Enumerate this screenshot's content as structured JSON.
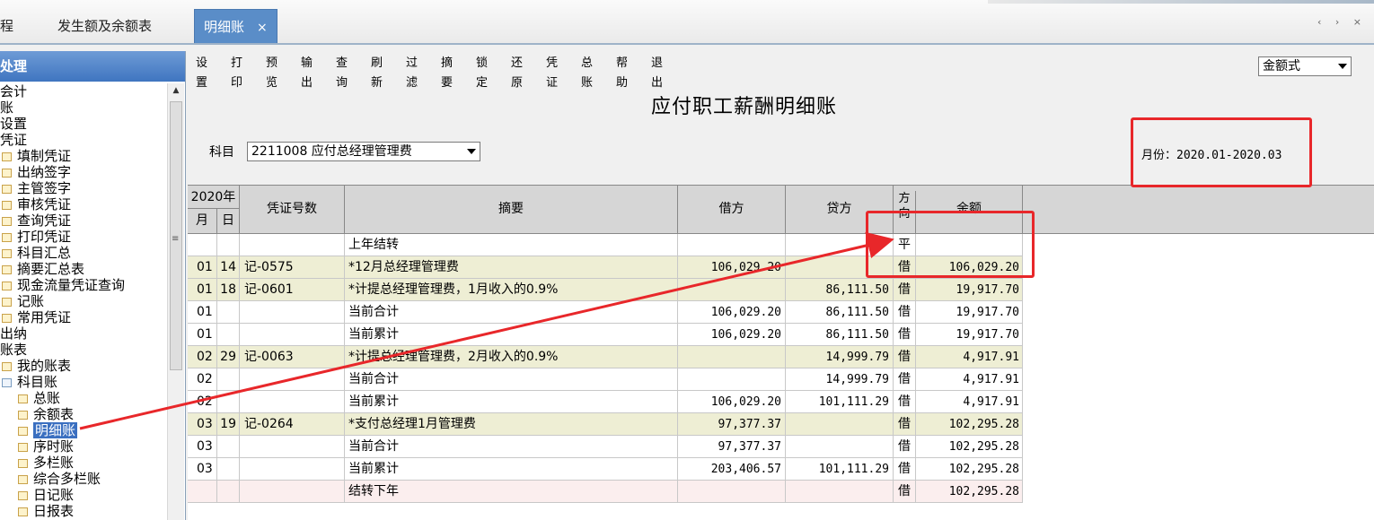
{
  "tabs": [
    {
      "label": "程"
    },
    {
      "label": "发生额及余额表"
    },
    {
      "label": "明细账",
      "active": true,
      "close": "×"
    }
  ],
  "tab_nav": "‹ › ×",
  "left_panel": {
    "header": "处理",
    "tree": [
      {
        "label": "会计",
        "indent": 0,
        "icon": "none"
      },
      {
        "label": "账",
        "indent": 0,
        "icon": "none"
      },
      {
        "label": "设置",
        "indent": 0,
        "icon": "none"
      },
      {
        "label": "凭证",
        "indent": 0,
        "icon": "none"
      },
      {
        "label": "填制凭证",
        "indent": 1,
        "icon": "folder-icon"
      },
      {
        "label": "出纳签字",
        "indent": 1,
        "icon": "folder-icon"
      },
      {
        "label": "主管签字",
        "indent": 1,
        "icon": "folder-icon"
      },
      {
        "label": "审核凭证",
        "indent": 1,
        "icon": "folder-icon"
      },
      {
        "label": "查询凭证",
        "indent": 1,
        "icon": "folder-icon"
      },
      {
        "label": "打印凭证",
        "indent": 1,
        "icon": "folder-icon"
      },
      {
        "label": "科目汇总",
        "indent": 1,
        "icon": "folder-icon"
      },
      {
        "label": "摘要汇总表",
        "indent": 1,
        "icon": "folder-icon"
      },
      {
        "label": "现金流量凭证查询",
        "indent": 1,
        "icon": "folder-icon"
      },
      {
        "label": "记账",
        "indent": 1,
        "icon": "folder-icon"
      },
      {
        "label": "常用凭证",
        "indent": 1,
        "icon": "folder-icon"
      },
      {
        "label": "出纳",
        "indent": 0,
        "icon": "none"
      },
      {
        "label": "账表",
        "indent": 0,
        "icon": "none"
      },
      {
        "label": "我的账表",
        "indent": 1,
        "icon": "folder-icon"
      },
      {
        "label": "科目账",
        "indent": 1,
        "icon": "folder-open-icon"
      },
      {
        "label": "总账",
        "indent": 2,
        "icon": "folder-icon"
      },
      {
        "label": "余额表",
        "indent": 2,
        "icon": "folder-icon"
      },
      {
        "label": "明细账",
        "indent": 2,
        "icon": "folder-icon",
        "selected": true
      },
      {
        "label": "序时账",
        "indent": 2,
        "icon": "folder-icon"
      },
      {
        "label": "多栏账",
        "indent": 2,
        "icon": "folder-icon"
      },
      {
        "label": "综合多栏账",
        "indent": 2,
        "icon": "folder-icon"
      },
      {
        "label": "日记账",
        "indent": 2,
        "icon": "folder-icon"
      },
      {
        "label": "日报表",
        "indent": 2,
        "icon": "folder-icon"
      }
    ]
  },
  "toolbar": [
    "设置",
    "打印",
    "预览",
    "输出",
    "查询",
    "刷新",
    "过滤",
    "摘要",
    "锁定",
    "还原",
    "凭证",
    "总账",
    "帮助",
    "退出"
  ],
  "mode_select": {
    "value": "金额式"
  },
  "report_title": "应付职工薪酬明细账",
  "subject": {
    "label": "科目",
    "value": "2211008 应付总经理管理费"
  },
  "period": "月份：2020.01-2020.03",
  "table": {
    "headers": {
      "year": "2020年",
      "month": "月",
      "day": "日",
      "voucher": "凭证号数",
      "summary": "摘要",
      "debit": "借方",
      "credit": "贷方",
      "direction": "方向",
      "balance": "余额"
    },
    "rows": [
      {
        "kind": "plain",
        "month": "",
        "day": "",
        "voucher": "",
        "summary": "上年结转",
        "debit": "",
        "credit": "",
        "dir": "平",
        "balance": ""
      },
      {
        "kind": "entry",
        "month": "01",
        "day": "14",
        "voucher": "记-0575",
        "summary": "*12月总经理管理费",
        "debit": "106,029.20",
        "credit": "",
        "dir": "借",
        "balance": "106,029.20"
      },
      {
        "kind": "entry",
        "month": "01",
        "day": "18",
        "voucher": "记-0601",
        "summary": "*计提总经理管理费，1月收入的0.9%",
        "debit": "",
        "credit": "86,111.50",
        "dir": "借",
        "balance": "19,917.70"
      },
      {
        "kind": "plain",
        "month": "01",
        "day": "",
        "voucher": "",
        "summary": "当前合计",
        "debit": "106,029.20",
        "credit": "86,111.50",
        "dir": "借",
        "balance": "19,917.70"
      },
      {
        "kind": "plain",
        "month": "01",
        "day": "",
        "voucher": "",
        "summary": "当前累计",
        "debit": "106,029.20",
        "credit": "86,111.50",
        "dir": "借",
        "balance": "19,917.70"
      },
      {
        "kind": "entry",
        "month": "02",
        "day": "29",
        "voucher": "记-0063",
        "summary": "*计提总经理管理费，2月收入的0.9%",
        "debit": "",
        "credit": "14,999.79",
        "dir": "借",
        "balance": "4,917.91"
      },
      {
        "kind": "plain",
        "month": "02",
        "day": "",
        "voucher": "",
        "summary": "当前合计",
        "debit": "",
        "credit": "14,999.79",
        "dir": "借",
        "balance": "4,917.91"
      },
      {
        "kind": "plain",
        "month": "02",
        "day": "",
        "voucher": "",
        "summary": "当前累计",
        "debit": "106,029.20",
        "credit": "101,111.29",
        "dir": "借",
        "balance": "4,917.91"
      },
      {
        "kind": "entry",
        "month": "03",
        "day": "19",
        "voucher": "记-0264",
        "summary": "*支付总经理1月管理费",
        "debit": "97,377.37",
        "credit": "",
        "dir": "借",
        "balance": "102,295.28"
      },
      {
        "kind": "plain",
        "month": "03",
        "day": "",
        "voucher": "",
        "summary": "当前合计",
        "debit": "97,377.37",
        "credit": "",
        "dir": "借",
        "balance": "102,295.28"
      },
      {
        "kind": "plain",
        "month": "03",
        "day": "",
        "voucher": "",
        "summary": "当前累计",
        "debit": "203,406.57",
        "credit": "101,111.29",
        "dir": "借",
        "balance": "102,295.28"
      },
      {
        "kind": "carry",
        "month": "",
        "day": "",
        "voucher": "",
        "summary": "结转下年",
        "debit": "",
        "credit": "",
        "dir": "借",
        "balance": "102,295.28"
      }
    ]
  },
  "colors": {
    "accent": "#5a8dc8",
    "annotation": "#e8272a",
    "entry_row": "#eeeed4",
    "carry_row": "#fbeeee"
  }
}
